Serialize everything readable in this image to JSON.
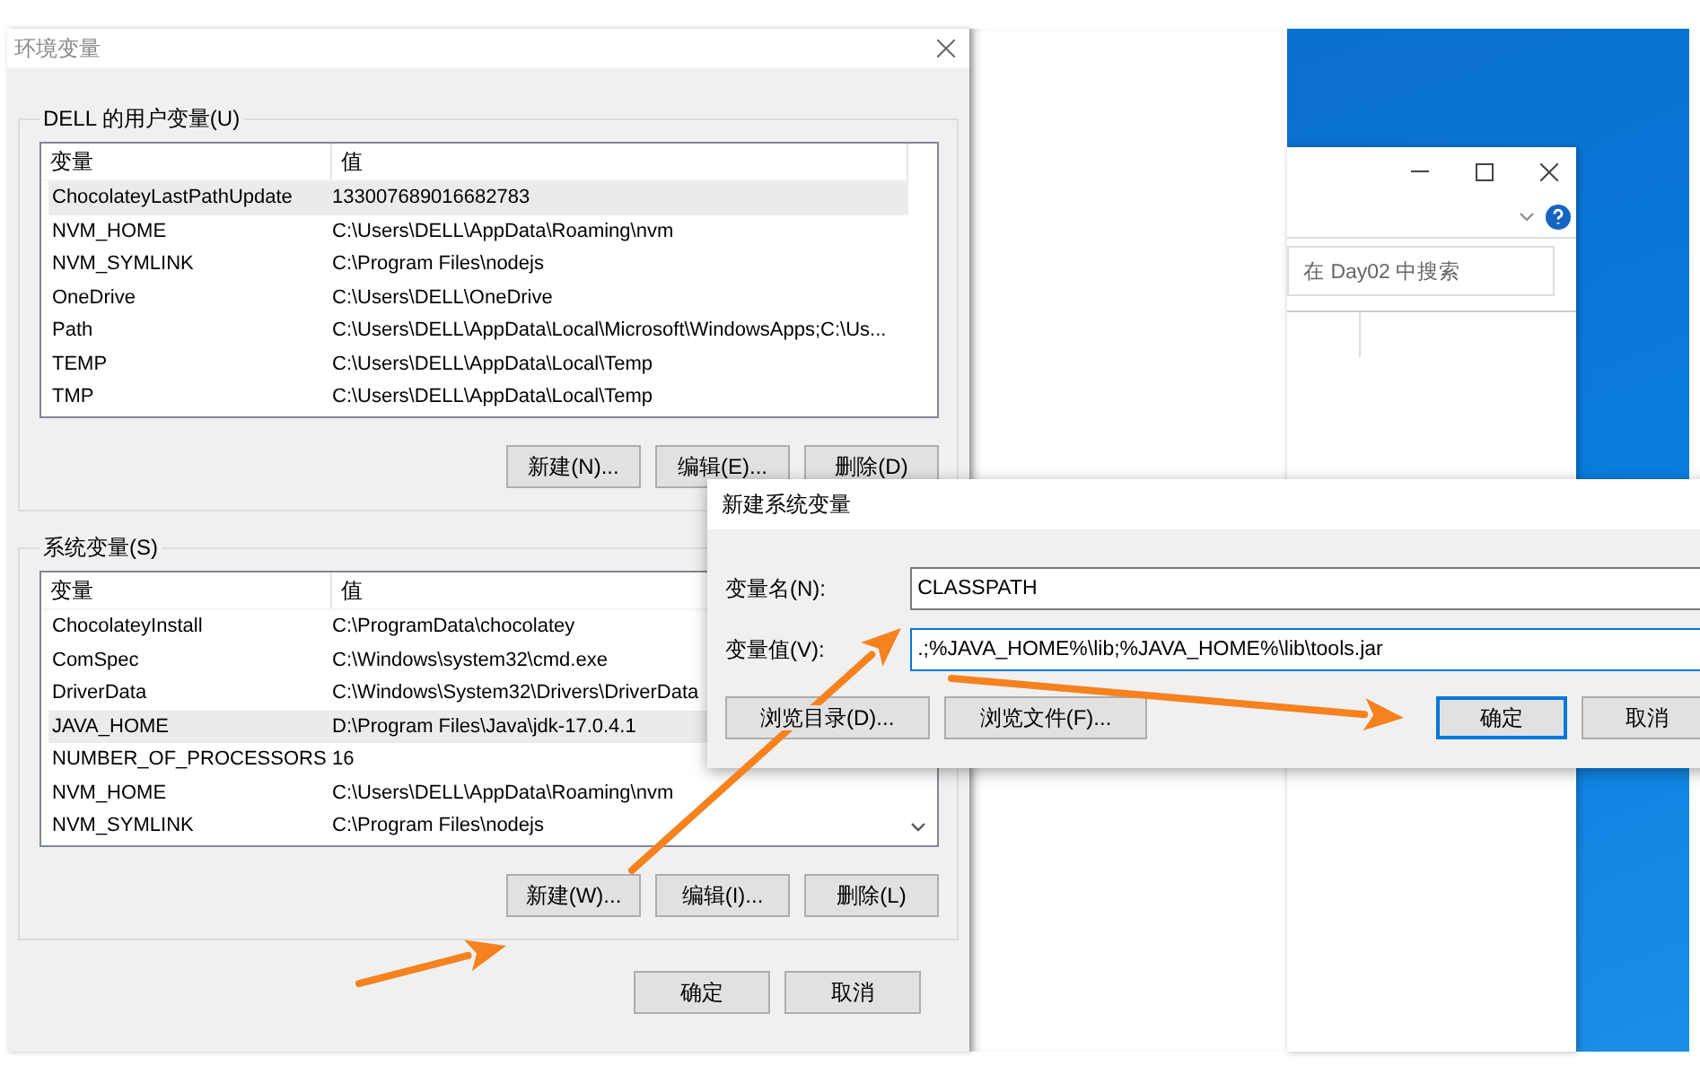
{
  "main_dialog": {
    "title": "环境变量",
    "user_section": {
      "title": "DELL 的用户变量(U)",
      "columns": [
        "变量",
        "值"
      ],
      "rows": [
        {
          "name": "ChocolateyLastPathUpdate",
          "value": "133007689016682783",
          "selected": true
        },
        {
          "name": "NVM_HOME",
          "value": "C:\\Users\\DELL\\AppData\\Roaming\\nvm",
          "selected": false
        },
        {
          "name": "NVM_SYMLINK",
          "value": "C:\\Program Files\\nodejs",
          "selected": false
        },
        {
          "name": "OneDrive",
          "value": "C:\\Users\\DELL\\OneDrive",
          "selected": false
        },
        {
          "name": "Path",
          "value": "C:\\Users\\DELL\\AppData\\Local\\Microsoft\\WindowsApps;C:\\Us...",
          "selected": false
        },
        {
          "name": "TEMP",
          "value": "C:\\Users\\DELL\\AppData\\Local\\Temp",
          "selected": false
        },
        {
          "name": "TMP",
          "value": "C:\\Users\\DELL\\AppData\\Local\\Temp",
          "selected": false
        }
      ],
      "buttons": [
        "新建(N)...",
        "编辑(E)...",
        "删除(D)"
      ]
    },
    "system_section": {
      "title": "系统变量(S)",
      "columns": [
        "变量",
        "值"
      ],
      "rows": [
        {
          "name": "ChocolateyInstall",
          "value": "C:\\ProgramData\\chocolatey",
          "selected": false
        },
        {
          "name": "ComSpec",
          "value": "C:\\Windows\\system32\\cmd.exe",
          "selected": false
        },
        {
          "name": "DriverData",
          "value": "C:\\Windows\\System32\\Drivers\\DriverData",
          "selected": false
        },
        {
          "name": "JAVA_HOME",
          "value": "D:\\Program Files\\Java\\jdk-17.0.4.1",
          "selected": true
        },
        {
          "name": "NUMBER_OF_PROCESSORS",
          "value": "16",
          "selected": false
        },
        {
          "name": "NVM_HOME",
          "value": "C:\\Users\\DELL\\AppData\\Roaming\\nvm",
          "selected": false
        },
        {
          "name": "NVM_SYMLINK",
          "value": "C:\\Program Files\\nodejs",
          "selected": false
        }
      ],
      "buttons": [
        "新建(W)...",
        "编辑(I)...",
        "删除(L)"
      ]
    },
    "buttons": [
      "确定",
      "取消"
    ]
  },
  "explorer": {
    "search_placeholder": "在 Day02 中搜索"
  },
  "new_var_dialog": {
    "title": "新建系统变量",
    "fields": [
      {
        "label": "变量名(N):",
        "value": "CLASSPATH",
        "focused": false
      },
      {
        "label": "变量值(V):",
        "value": ".;%JAVA_HOME%\\lib;%JAVA_HOME%\\lib\\tools.jar",
        "focused": true
      }
    ],
    "buttons": [
      {
        "label": "浏览目录(D)...",
        "default": false
      },
      {
        "label": "浏览文件(F)...",
        "default": false
      },
      {
        "label": "确定",
        "default": true
      },
      {
        "label": "取消",
        "default": false
      }
    ]
  }
}
